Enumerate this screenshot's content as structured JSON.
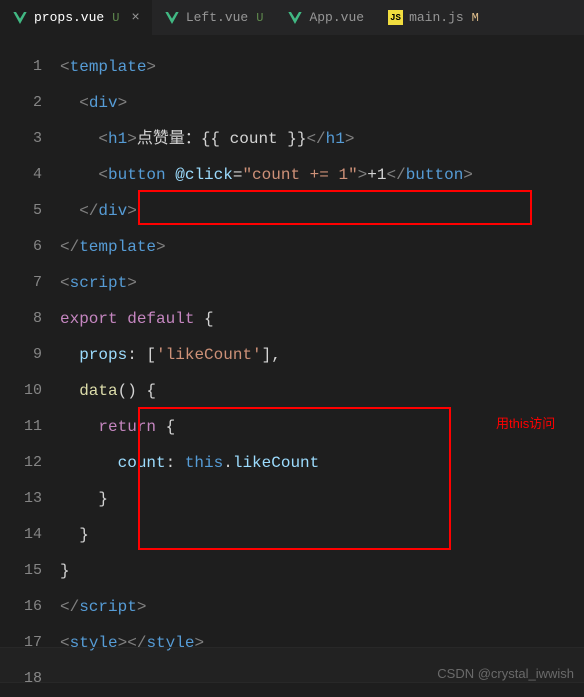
{
  "tabs": [
    {
      "name": "props.vue",
      "status": "U",
      "active": true,
      "icon": "vue"
    },
    {
      "name": "Left.vue",
      "status": "U",
      "active": false,
      "icon": "vue"
    },
    {
      "name": "App.vue",
      "status": "",
      "active": false,
      "icon": "vue"
    },
    {
      "name": "main.js",
      "status": "M",
      "active": false,
      "icon": "js"
    }
  ],
  "lineNumbers": [
    "1",
    "2",
    "3",
    "4",
    "5",
    "6",
    "7",
    "8",
    "9",
    "10",
    "11",
    "12",
    "13",
    "14",
    "15",
    "16",
    "17",
    "18"
  ],
  "tokens": {
    "lt": "<",
    "gt": ">",
    "lts": "</",
    "template": "template",
    "div": "div",
    "h1": "h1",
    "button": "button",
    "script": "script",
    "style": "style",
    "click": "@click",
    "eq": "=",
    "clickVal": "\"count += 1\"",
    "plus1": "+1",
    "h1text": "点赞量：{{ count }}",
    "export": "export",
    "default": "default",
    "lbrace": "{",
    "rbrace": "}",
    "props": "props",
    "colon": ": ",
    "lbracket": "[",
    "rbracket": "]",
    "likeCountStr": "'likeCount'",
    "comma": ",",
    "data": "data",
    "parens": "()",
    "return": "return",
    "count": "count",
    "this": "this",
    "dot": ".",
    "likeCount": "likeCount"
  },
  "annotation": "用this访问",
  "watermark": "CSDN @crystal_iwwish",
  "closeIcon": "×",
  "jsLabel": "JS"
}
